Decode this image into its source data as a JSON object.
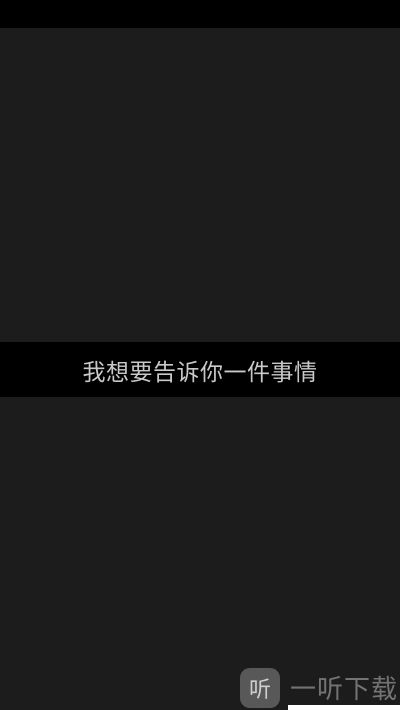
{
  "caption": {
    "text": "我想要告诉你一件事情"
  },
  "watermark": {
    "logo_text": "听",
    "site_text": "一听下载"
  },
  "colors": {
    "background": "#1c1c1c",
    "band": "#000000",
    "caption_text": "#c9c9c9"
  }
}
